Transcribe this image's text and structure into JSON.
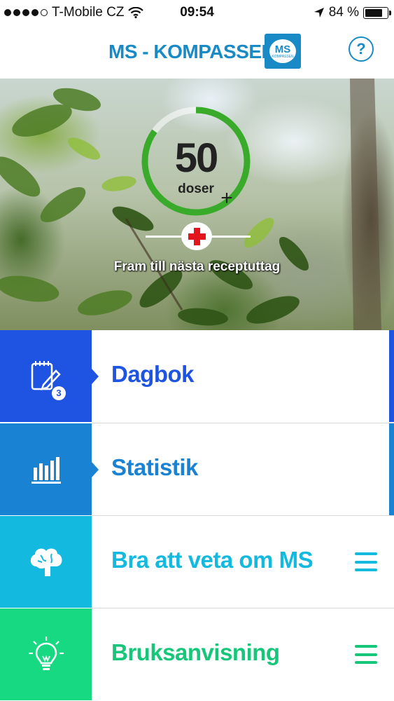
{
  "status_bar": {
    "carrier": "T-Mobile CZ",
    "time": "09:54",
    "battery": "84 %",
    "battery_level": 0.84,
    "signal_bars": 4,
    "icons": [
      "signal-dots-icon",
      "wifi-icon",
      "location-arrow-icon",
      "battery-icon"
    ]
  },
  "header": {
    "title": "MS - KOMPASSEN",
    "logo_text": "MS",
    "logo_sub": "KOMPASSEN",
    "help_label": "?"
  },
  "hero": {
    "dose_count": "50",
    "dose_unit": "doser",
    "dose_progress": 0.85,
    "add_label": "+",
    "caption": "Fram till nästa receptuttag"
  },
  "menu": {
    "items": [
      {
        "label": "Dagbok",
        "icon": "diary-pencil-icon",
        "badge": "3",
        "tile_color": "#1f54e3",
        "text_color": "#1f54e3"
      },
      {
        "label": "Statistik",
        "icon": "bar-chart-icon",
        "tile_color": "#1a82d2",
        "text_color": "#1a82d2"
      },
      {
        "label": "Bra att veta om MS",
        "icon": "brain-icon",
        "tile_color": "#13b9df",
        "text_color": "#13b9df"
      },
      {
        "label": "Bruksanvisning",
        "icon": "lightbulb-icon",
        "tile_color": "#16d981",
        "text_color": "#16c77a"
      }
    ]
  },
  "colors": {
    "brand": "#1a8ac7",
    "ring": "#3aaa2a",
    "cross": "#e3141b"
  }
}
